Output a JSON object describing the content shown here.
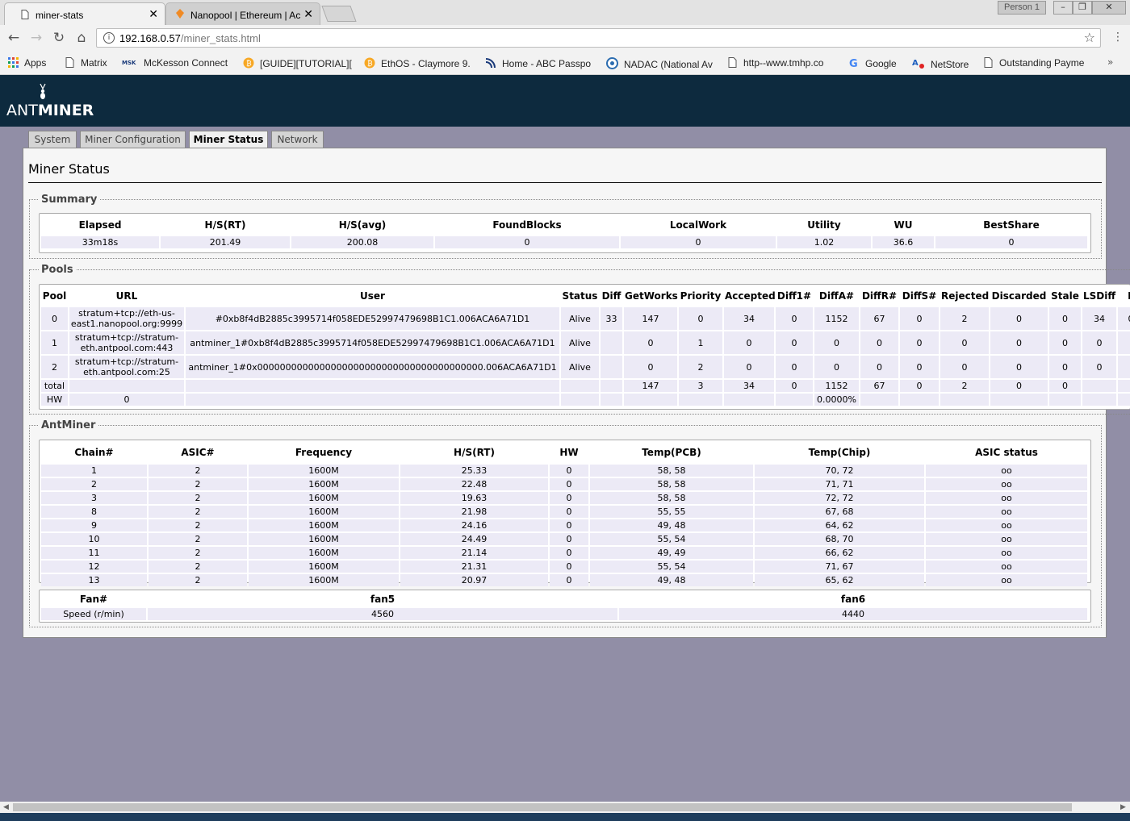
{
  "browser": {
    "tabs": [
      {
        "title": "miner-stats"
      },
      {
        "title": "Nanopool | Ethereum | Ac"
      }
    ],
    "profile": "Person 1",
    "url_host": "192.168.0.57",
    "url_path": "/miner_stats.html",
    "bookmarks": [
      {
        "label": "Apps",
        "icon": "apps-grid-icon"
      },
      {
        "label": "Matrix",
        "icon": "page-icon"
      },
      {
        "label": "McKesson Connect",
        "icon": "mckesson-icon"
      },
      {
        "label": "[GUIDE][TUTORIAL][",
        "icon": "bitcoin-icon"
      },
      {
        "label": "EthOS - Claymore 9.",
        "icon": "bitcoin-icon"
      },
      {
        "label": "Home - ABC Passpo",
        "icon": "abc-icon"
      },
      {
        "label": "NADAC (National Av",
        "icon": "nadac-icon"
      },
      {
        "label": "http--www.tmhp.co",
        "icon": "page-icon"
      },
      {
        "label": "Google",
        "icon": "google-icon"
      },
      {
        "label": "NetStore",
        "icon": "netstore-icon"
      },
      {
        "label": "Outstanding Payme",
        "icon": "page-icon"
      }
    ],
    "more_bookmarks": "»"
  },
  "logo": {
    "ant": "ANT",
    "miner": "MINER"
  },
  "nav_tabs": [
    "System",
    "Miner Configuration",
    "Miner Status",
    "Network"
  ],
  "page_title": "Miner Status",
  "summary": {
    "legend": "Summary",
    "headers": [
      "Elapsed",
      "H/S(RT)",
      "H/S(avg)",
      "FoundBlocks",
      "LocalWork",
      "Utility",
      "WU",
      "BestShare"
    ],
    "row": [
      "33m18s",
      "201.49",
      "200.08",
      "0",
      "0",
      "1.02",
      "36.6",
      "0"
    ]
  },
  "pools": {
    "legend": "Pools",
    "headers": [
      "Pool",
      "URL",
      "User",
      "Status",
      "Diff",
      "GetWorks",
      "Priority",
      "Accepted",
      "Diff1#",
      "DiffA#",
      "DiffR#",
      "DiffS#",
      "Rejected",
      "Discarded",
      "Stale",
      "LSDiff",
      "L"
    ],
    "rows": [
      {
        "pool": "0",
        "url": "stratum+tcp://eth-us-east1.nanopool.org:9999",
        "user": "#0xb8f4dB2885c3995714f058EDE52997479698B1C1.006ACA6A71D1",
        "status": "Alive",
        "diff": "33",
        "getworks": "147",
        "priority": "0",
        "accepted": "34",
        "diff1": "0",
        "diffa": "1152",
        "diffr": "67",
        "diffs": "0",
        "rejected": "2",
        "discarded": "0",
        "stale": "0",
        "lsdiff": "34",
        "l": "0"
      },
      {
        "pool": "1",
        "url": "stratum+tcp://stratum-eth.antpool.com:443",
        "user": "antminer_1#0xb8f4dB2885c3995714f058EDE52997479698B1C1.006ACA6A71D1",
        "status": "Alive",
        "diff": "",
        "getworks": "0",
        "priority": "1",
        "accepted": "0",
        "diff1": "0",
        "diffa": "0",
        "diffr": "0",
        "diffs": "0",
        "rejected": "0",
        "discarded": "0",
        "stale": "0",
        "lsdiff": "0",
        "l": ""
      },
      {
        "pool": "2",
        "url": "stratum+tcp://stratum-eth.antpool.com:25",
        "user": "antminer_1#0x0000000000000000000000000000000000000000.006ACA6A71D1",
        "status": "Alive",
        "diff": "",
        "getworks": "0",
        "priority": "2",
        "accepted": "0",
        "diff1": "0",
        "diffa": "0",
        "diffr": "0",
        "diffs": "0",
        "rejected": "0",
        "discarded": "0",
        "stale": "0",
        "lsdiff": "0",
        "l": ""
      }
    ],
    "total": {
      "label": "total",
      "getworks": "147",
      "priority": "3",
      "accepted": "34",
      "diff1": "0",
      "diffa": "1152",
      "diffr": "67",
      "diffs": "0",
      "rejected": "2",
      "discarded": "0",
      "stale": "0"
    },
    "hw": {
      "label": "HW",
      "value": "0",
      "percent": "0.0000%"
    }
  },
  "antminer": {
    "legend": "AntMiner",
    "headers": [
      "Chain#",
      "ASIC#",
      "Frequency",
      "H/S(RT)",
      "HW",
      "Temp(PCB)",
      "Temp(Chip)",
      "ASIC status"
    ],
    "rows": [
      [
        "1",
        "2",
        "1600M",
        "25.33",
        "0",
        "58, 58",
        "70, 72",
        "oo"
      ],
      [
        "2",
        "2",
        "1600M",
        "22.48",
        "0",
        "58, 58",
        "71, 71",
        "oo"
      ],
      [
        "3",
        "2",
        "1600M",
        "19.63",
        "0",
        "58, 58",
        "72, 72",
        "oo"
      ],
      [
        "8",
        "2",
        "1600M",
        "21.98",
        "0",
        "55, 55",
        "67, 68",
        "oo"
      ],
      [
        "9",
        "2",
        "1600M",
        "24.16",
        "0",
        "49, 48",
        "64, 62",
        "oo"
      ],
      [
        "10",
        "2",
        "1600M",
        "24.49",
        "0",
        "55, 54",
        "68, 70",
        "oo"
      ],
      [
        "11",
        "2",
        "1600M",
        "21.14",
        "0",
        "49, 49",
        "66, 62",
        "oo"
      ],
      [
        "12",
        "2",
        "1600M",
        "21.31",
        "0",
        "55, 54",
        "71, 67",
        "oo"
      ],
      [
        "13",
        "2",
        "1600M",
        "20.97",
        "0",
        "49, 48",
        "65, 62",
        "oo"
      ]
    ],
    "fans": {
      "headers": [
        "Fan#",
        "fan5",
        "fan6"
      ],
      "row": [
        "Speed (r/min)",
        "4560",
        "4440"
      ]
    }
  }
}
